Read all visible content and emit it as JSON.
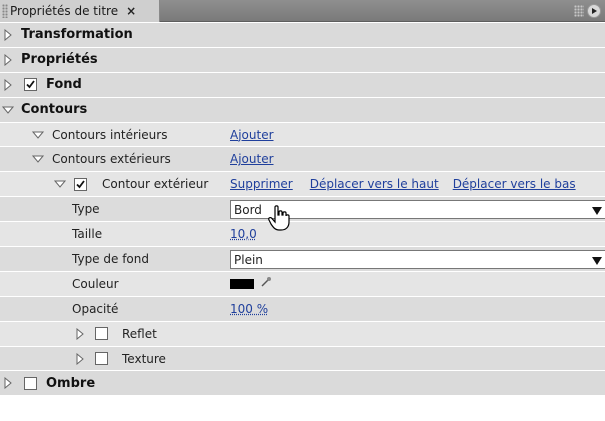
{
  "panel": {
    "title": "Propriétés de titre",
    "close": "×"
  },
  "sections": {
    "transformation": "Transformation",
    "proprietes": "Propriétés",
    "fond": "Fond",
    "contours": "Contours",
    "ombre": "Ombre"
  },
  "contours": {
    "interieurs": {
      "label": "Contours intérieurs",
      "action": "Ajouter"
    },
    "exterieurs": {
      "label": "Contours extérieurs",
      "action": "Ajouter"
    },
    "exterieur": {
      "label": "Contour extérieur",
      "delete": "Supprimer",
      "up": "Déplacer vers le haut",
      "down": "Déplacer vers le bas"
    }
  },
  "props": {
    "type": {
      "label": "Type",
      "value": "Bord"
    },
    "taille": {
      "label": "Taille",
      "value": "10,0"
    },
    "type_fond": {
      "label": "Type de fond",
      "value": "Plein"
    },
    "couleur": {
      "label": "Couleur",
      "value": "#000000"
    },
    "opacite": {
      "label": "Opacité",
      "value": "100 %"
    },
    "reflet": {
      "label": "Reflet"
    },
    "texture": {
      "label": "Texture"
    }
  }
}
